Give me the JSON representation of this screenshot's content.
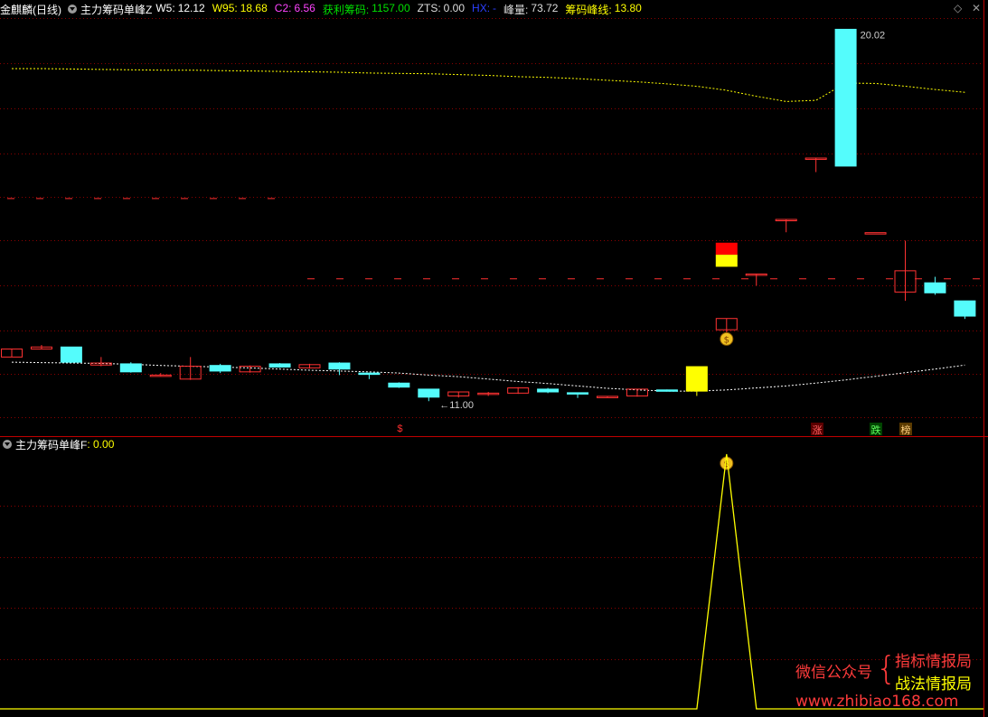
{
  "header": {
    "stock_name": "金麒麟",
    "period": "(日线)",
    "indicator": "主力筹码单峰Z",
    "fields": [
      {
        "label": "W5:",
        "value": "12.12",
        "color": "#ffffff"
      },
      {
        "label": "W95:",
        "value": "18.68",
        "color": "#ffff00"
      },
      {
        "label": "C2:",
        "value": "6.56",
        "color": "#ff44ff"
      },
      {
        "label": "获利筹码:",
        "value": "1157.00",
        "color": "#00e000"
      },
      {
        "label": "ZTS:",
        "value": "0.00",
        "color": "#dddddd"
      },
      {
        "label": "HX:",
        "value": "-",
        "color": "#2c40ff"
      },
      {
        "label": "峰量:",
        "value": "73.72",
        "color": "#dddddd"
      },
      {
        "label": "筹码峰线:",
        "value": "13.80",
        "color": "#ffff00"
      }
    ]
  },
  "lower_header": {
    "indicator": "主力筹码单峰F",
    "value": ": 0.00"
  },
  "labels": {
    "high": "20.02",
    "low": "11.00",
    "zhang": "涨",
    "die": "跌",
    "bang": "榜"
  },
  "watermark": {
    "wechat": "微信公众号",
    "brace": "{",
    "line1": "指标情报局",
    "line2": "战法情报局",
    "url": "www.zhibiao168.com"
  },
  "controls": {
    "diamond": "◇",
    "close": "✕"
  },
  "colors": {
    "up": "#ff3232",
    "down": "#54fcfc",
    "ma": "#ffff00",
    "chip_low": "#ffffff",
    "grid": "#8b0000",
    "signal": "#ffff00"
  },
  "chart_data": {
    "type": "candlestick",
    "upper_panel": {
      "candles": [
        {
          "o": 11.85,
          "c": 12.05,
          "h": 12.05,
          "l": 11.85
        },
        {
          "o": 12.05,
          "c": 12.1,
          "h": 12.15,
          "l": 12.05
        },
        {
          "o": 12.1,
          "c": 11.72,
          "h": 12.1,
          "l": 11.7
        },
        {
          "o": 11.65,
          "c": 11.7,
          "h": 11.85,
          "l": 11.62
        },
        {
          "o": 11.68,
          "c": 11.48,
          "h": 11.72,
          "l": 11.46
        },
        {
          "o": 11.4,
          "c": 11.4,
          "h": 11.45,
          "l": 11.38
        },
        {
          "o": 11.3,
          "c": 11.62,
          "h": 11.85,
          "l": 11.28
        },
        {
          "o": 11.64,
          "c": 11.5,
          "h": 11.68,
          "l": 11.45
        },
        {
          "o": 11.48,
          "c": 11.62,
          "h": 11.64,
          "l": 11.46
        },
        {
          "o": 11.68,
          "c": 11.6,
          "h": 11.7,
          "l": 11.58
        },
        {
          "o": 11.58,
          "c": 11.66,
          "h": 11.68,
          "l": 11.56
        },
        {
          "o": 11.7,
          "c": 11.55,
          "h": 11.72,
          "l": 11.4
        },
        {
          "o": 11.45,
          "c": 11.43,
          "h": 11.45,
          "l": 11.3
        },
        {
          "o": 11.2,
          "c": 11.1,
          "h": 11.22,
          "l": 11.08
        },
        {
          "o": 11.05,
          "c": 10.85,
          "h": 11.05,
          "l": 10.75
        },
        {
          "o": 10.88,
          "c": 10.98,
          "h": 10.98,
          "l": 10.84
        },
        {
          "o": 10.95,
          "c": 10.95,
          "h": 10.98,
          "l": 10.88
        },
        {
          "o": 10.95,
          "c": 11.08,
          "h": 11.1,
          "l": 10.93
        },
        {
          "o": 11.05,
          "c": 10.98,
          "h": 11.08,
          "l": 10.95
        },
        {
          "o": 10.96,
          "c": 10.94,
          "h": 10.96,
          "l": 10.83
        },
        {
          "o": 10.85,
          "c": 10.87,
          "h": 10.88,
          "l": 10.84
        },
        {
          "o": 10.88,
          "c": 11.05,
          "h": 11.05,
          "l": 10.86
        },
        {
          "o": 11.03,
          "c": 11.01,
          "h": 11.04,
          "l": 11.0
        },
        {
          "o": 11.0,
          "c": 11.61,
          "h": 11.61,
          "l": 10.88
        },
        {
          "o": 12.53,
          "c": 12.81,
          "h": 12.81,
          "l": 12.3
        },
        {
          "o": 13.92,
          "c": 13.92,
          "h": 13.92,
          "l": 13.63
        },
        {
          "o": 15.28,
          "c": 15.28,
          "h": 15.28,
          "l": 14.96
        },
        {
          "o": 16.81,
          "c": 16.81,
          "h": 16.81,
          "l": 16.46
        },
        {
          "o": 20.02,
          "c": 16.61,
          "h": 20.02,
          "l": 16.61
        },
        {
          "o": 14.95,
          "c": 14.95,
          "h": 14.95,
          "l": 14.95
        },
        {
          "o": 13.47,
          "c": 14.0,
          "h": 14.75,
          "l": 13.25
        },
        {
          "o": 13.7,
          "c": 13.45,
          "h": 13.85,
          "l": 13.4
        },
        {
          "o": 13.25,
          "c": 12.87,
          "h": 13.25,
          "l": 12.8
        }
      ],
      "ma_upper": [
        19.04,
        19.04,
        19.03,
        19.02,
        19.01,
        19.0,
        19.0,
        18.99,
        18.98,
        18.97,
        18.96,
        18.95,
        18.93,
        18.92,
        18.91,
        18.89,
        18.87,
        18.84,
        18.82,
        18.79,
        18.75,
        18.71,
        18.66,
        18.6,
        18.5,
        18.35,
        18.22,
        18.25,
        18.68,
        18.67,
        18.6,
        18.52,
        18.45
      ],
      "ma_lower": [
        11.72,
        11.71,
        11.7,
        11.69,
        11.67,
        11.64,
        11.62,
        11.6,
        11.58,
        11.55,
        11.52,
        11.5,
        11.48,
        11.45,
        11.4,
        11.36,
        11.3,
        11.24,
        11.19,
        11.13,
        11.07,
        11.03,
        11.0,
        11.0,
        11.03,
        11.08,
        11.13,
        11.2,
        11.28,
        11.37,
        11.46,
        11.55,
        11.65
      ],
      "zero_up_dash": 15.8,
      "chip_peak_line": 13.8,
      "ylim": [
        10.35,
        20.3
      ]
    },
    "lower_panel": {
      "values": [
        0,
        0,
        0,
        0,
        0,
        0,
        0,
        0,
        0,
        0,
        0,
        0,
        0,
        0,
        0,
        0,
        0,
        0,
        0,
        0,
        0,
        0,
        0,
        0,
        1,
        0,
        0,
        0,
        0,
        0,
        0,
        0,
        0
      ],
      "ylim": [
        0,
        1
      ]
    }
  }
}
